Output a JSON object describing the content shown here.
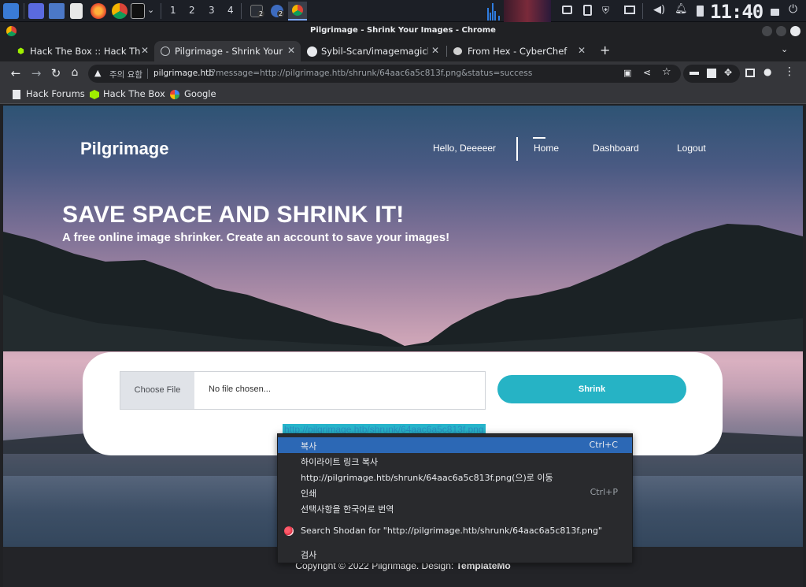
{
  "taskbar": {
    "workspaces": [
      "1",
      "2",
      "3",
      "4"
    ],
    "badges": [
      "2",
      "2"
    ],
    "clock": "11:40"
  },
  "window": {
    "title": "Pilgrimage - Shrink Your Images - Chrome"
  },
  "tabs": [
    {
      "label": "Hack The Box :: Hack The B",
      "icon": "hackthebox-icon"
    },
    {
      "label": "Pilgrimage - Shrink Your I",
      "icon": "globe-icon",
      "active": true
    },
    {
      "label": "Sybil-Scan/imagemagick-l",
      "icon": "github-icon"
    },
    {
      "label": "From Hex - CyberChef",
      "icon": "chef-icon"
    }
  ],
  "omnibox": {
    "security_label": "주의 요함",
    "url_host": "pilgrimage.htb",
    "url_rest": "/?message=http://pilgrimage.htb/shrunk/64aac6a5c813f.png&status=success"
  },
  "bookmarks": [
    {
      "label": "Hack Forums"
    },
    {
      "label": "Hack The Box"
    },
    {
      "label": "Google"
    }
  ],
  "site": {
    "brand": "Pilgrimage",
    "nav": {
      "greeting": "Hello, Deeeeer",
      "home": "Home",
      "dashboard": "Dashboard",
      "logout": "Logout"
    },
    "hero_title": "SAVE SPACE AND SHRINK IT!",
    "hero_subtitle": "A free online image shrinker. Create an account to save your images!",
    "upload": {
      "choose_label": "Choose File",
      "file_status": "No file chosen...",
      "shrink_label": "Shrink"
    },
    "result_link": "http://pilgrimage.htb/shrunk/64aac6a5c813f.png",
    "footer": "Copyright © 2022 Pilgrimage. Design: ",
    "footer_link": "TemplateMo"
  },
  "context_menu": [
    {
      "label": "복사",
      "shortcut": "Ctrl+C",
      "highlighted": true
    },
    {
      "label": "하이라이트 링크 복사",
      "shortcut": ""
    },
    {
      "label": "http://pilgrimage.htb/shrunk/64aac6a5c813f.png(으)로 이동",
      "shortcut": ""
    },
    {
      "label": "인쇄",
      "shortcut": "Ctrl+P"
    },
    {
      "label": "선택사항을 한국어로 번역",
      "shortcut": ""
    },
    {
      "label": "Search Shodan for \"http://pilgrimage.htb/shrunk/64aac6a5c813f.png\"",
      "shortcut": "",
      "icon": "shodan-icon"
    },
    {
      "label": "검사",
      "shortcut": ""
    }
  ]
}
